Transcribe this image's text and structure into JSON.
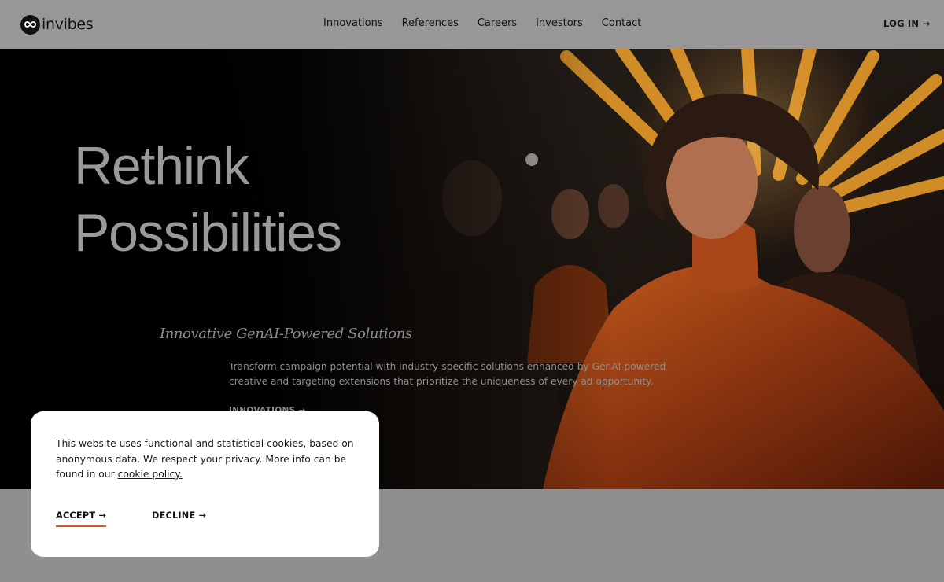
{
  "brand": {
    "name": "invibes"
  },
  "nav": {
    "items": [
      "Innovations",
      "References",
      "Careers",
      "Investors",
      "Contact"
    ],
    "login_label": "LOG IN →"
  },
  "hero": {
    "headline_line1": "Rethink",
    "headline_line2": "Possibilities",
    "subtitle": "Innovative GenAI-Powered Solutions",
    "description": "Transform campaign potential with industry-specific solutions enhanced by GenAI-powered creative and targeting extensions that prioritize the uniqueness of every ad opportunity.",
    "cta_label": "INNOVATIONS →"
  },
  "cookie_banner": {
    "text": "This website uses functional and statistical cookies, based on anonymous data. We respect your privacy. More info can be found in our",
    "link_label": "cookie policy.",
    "accept_label": "ACCEPT →",
    "decline_label": "DECLINE →"
  },
  "colors": {
    "accent": "#d9581b",
    "header_bg": "#979797",
    "overlay": "#8f8f8f"
  }
}
